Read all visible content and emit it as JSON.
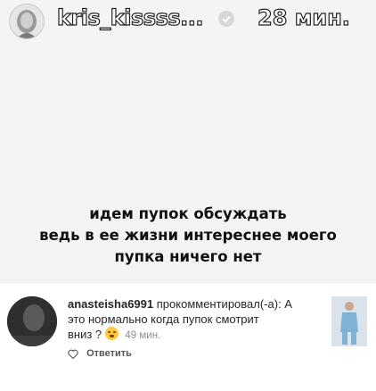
{
  "header": {
    "username": "kris_kissss...",
    "time": "28 мин."
  },
  "caption": {
    "lines": [
      "идем пупок обсуждать",
      "ведь в ее жизни интереснее моего",
      "пупка ничего нет"
    ]
  },
  "comment": {
    "username": "anasteisha6991",
    "action": "прокомментировал(-а): А",
    "text_line2": "это нормально когда пупок смотрит",
    "text_line3": "вниз ?",
    "emoji": "face-with-hand-over-mouth-emoji",
    "time": "49 мин.",
    "reply_label": "Ответить"
  },
  "icons": {
    "verified": "verified-badge-icon",
    "heart": "heart-icon"
  }
}
